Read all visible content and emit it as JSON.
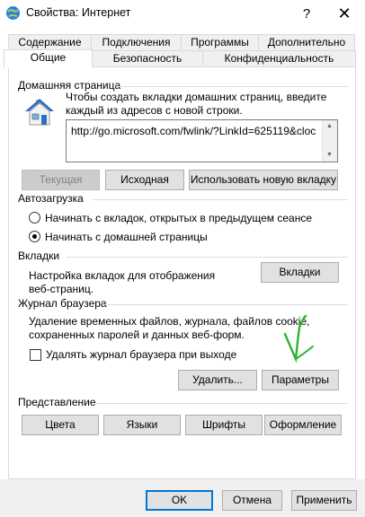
{
  "window": {
    "title": "Свойства: Интернет",
    "help_symbol": "?",
    "close_symbol": "✕"
  },
  "tabs_row1": [
    "Содержание",
    "Подключения",
    "Программы",
    "Дополнительно"
  ],
  "tabs_row2": [
    "Общие",
    "Безопасность",
    "Конфиденциальность"
  ],
  "active_tab": "Общие",
  "homepage": {
    "group_title": "Домашняя страница",
    "instruction_line1": "Чтобы создать вкладки домашних страниц, введите",
    "instruction_line2": "каждый из адресов с новой строки.",
    "url_value": "http://go.microsoft.com/fwlink/?LinkId=625119&cloc",
    "btn_current": "Текущая",
    "btn_default": "Исходная",
    "btn_new_tab": "Использовать новую вкладку"
  },
  "startup": {
    "group_title": "Автозагрузка",
    "option1": "Начинать с вкладок, открытых в предыдущем сеансе",
    "option2": "Начинать с домашней страницы",
    "selected": 2
  },
  "tabs_group": {
    "group_title": "Вкладки",
    "desc_line1": "Настройка вкладок для отображения",
    "desc_line2": "веб-страниц.",
    "btn": "Вкладки"
  },
  "history": {
    "group_title": "Журнал браузера",
    "desc_line1": "Удаление временных файлов, журнала, файлов cookie,",
    "desc_line2": "сохраненных паролей и данных веб-форм.",
    "checkbox_label": "Удалять журнал браузера при выходе",
    "checkbox_checked": false,
    "btn_delete": "Удалить...",
    "btn_settings": "Параметры"
  },
  "appearance": {
    "group_title": "Представление",
    "btn_colors": "Цвета",
    "btn_languages": "Языки",
    "btn_fonts": "Шрифты",
    "btn_accessibility": "Оформление"
  },
  "footer": {
    "ok": "OK",
    "cancel": "Отмена",
    "apply": "Применить"
  },
  "colors": {
    "annotation_check": "#2bb52b",
    "focus_border": "#0078d7"
  }
}
